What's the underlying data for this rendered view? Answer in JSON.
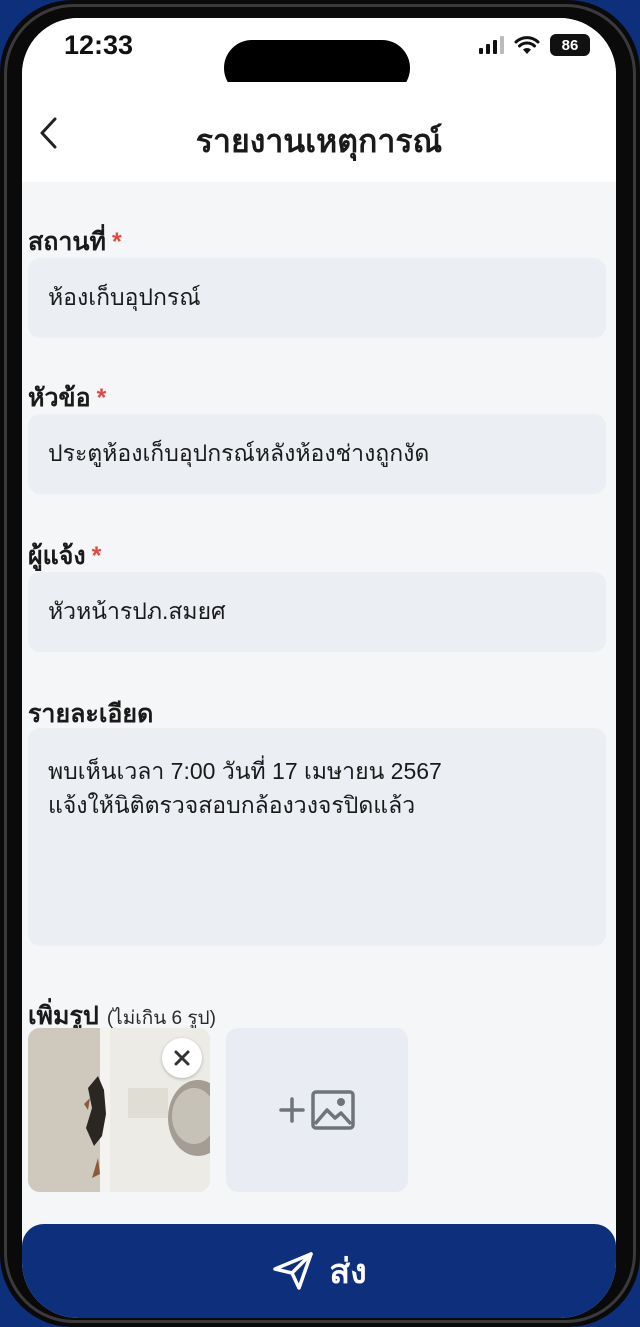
{
  "status_bar": {
    "time": "12:33",
    "battery": "86",
    "icons": [
      "signal-icon",
      "wifi-icon",
      "battery-icon"
    ]
  },
  "header": {
    "back_icon": "chevron-left-icon",
    "title": "รายงานเหตุการณ์"
  },
  "form": {
    "location": {
      "label": "สถานที่",
      "required_mark": "*",
      "value": "ห้องเก็บอุปกรณ์"
    },
    "subject": {
      "label": "หัวข้อ",
      "required_mark": "*",
      "value": "ประตูห้องเก็บอุปกรณ์หลังห้องช่างถูกงัด"
    },
    "reporter": {
      "label": "ผู้แจ้ง",
      "required_mark": "*",
      "value": "หัวหน้ารปภ.สมยศ"
    },
    "details": {
      "label": "รายละเอียด",
      "value": "พบเห็นเวลา 7:00 วันที่ 17 เมษายน 2567\nแจ้งให้นิติตรวจสอบกล้องวงจรปิดแล้ว"
    },
    "photos": {
      "label": "เพิ่มรูป",
      "hint": "(ไม่เกิน 6 รูป)",
      "count": 1,
      "remove_icon": "close-icon",
      "add_icon": "add-image-icon"
    }
  },
  "footer": {
    "submit_label": "ส่ง",
    "submit_icon": "send-icon"
  },
  "colors": {
    "primary": "#0d2f7c",
    "required": "#e04a3f",
    "field_bg": "#ebeef3",
    "page_bg": "#f5f6f8"
  }
}
